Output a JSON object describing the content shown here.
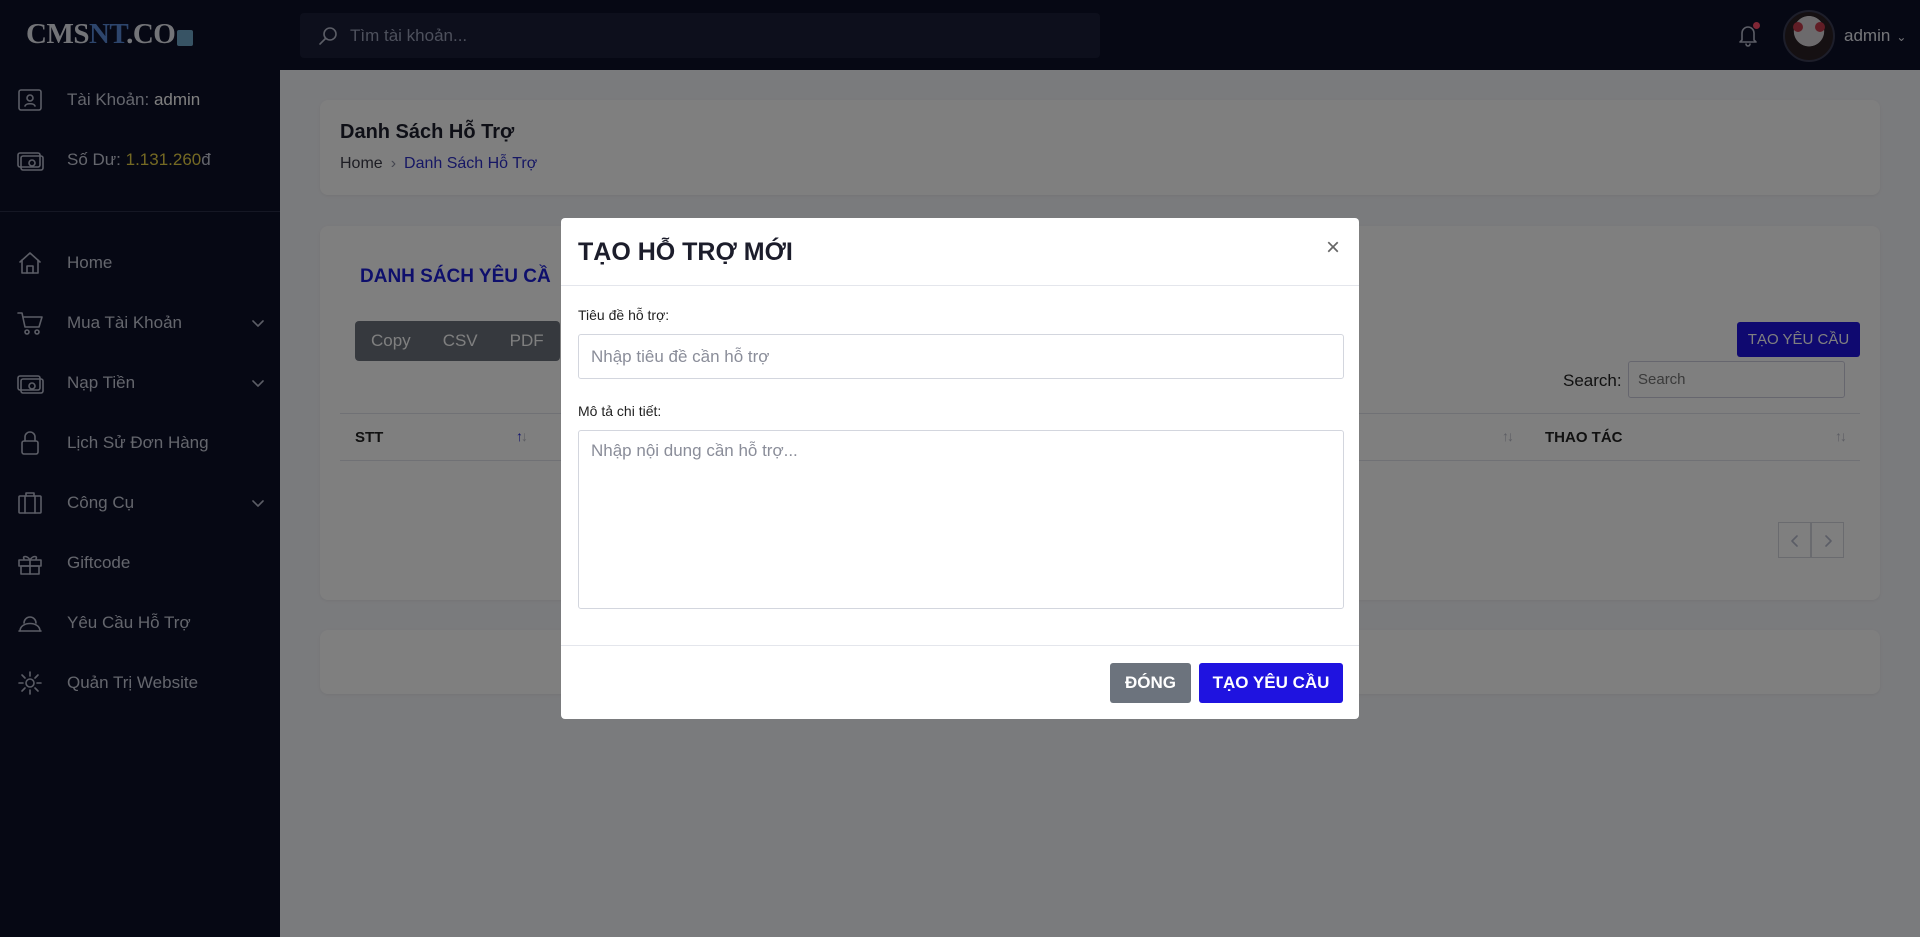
{
  "topbar": {
    "logo_prefix": "CMS",
    "logo_accent": "NT",
    "logo_suffix": ".CO",
    "search_placeholder": "Tìm tài khoản...",
    "username": "admin"
  },
  "sidebar": {
    "account_label": "Tài Khoản: ",
    "account_value": "admin",
    "balance_label": "Số Dư: ",
    "balance_value": "1.131.260",
    "balance_currency": "đ",
    "items": [
      {
        "label": "Home",
        "icon": "home-icon"
      },
      {
        "label": "Mua Tài Khoản",
        "icon": "cart-icon",
        "has_children": true
      },
      {
        "label": "Nạp Tiền",
        "icon": "money-icon",
        "has_children": true
      },
      {
        "label": "Lịch Sử Đơn Hàng",
        "icon": "lock-icon"
      },
      {
        "label": "Công Cụ",
        "icon": "briefcase-icon",
        "has_children": true
      },
      {
        "label": "Giftcode",
        "icon": "gift-icon"
      },
      {
        "label": "Yêu Cầu Hỗ Trợ",
        "icon": "support-icon"
      },
      {
        "label": "Quản Trị Website",
        "icon": "gear-icon"
      }
    ]
  },
  "main": {
    "page_title": "Danh Sách Hỗ Trợ",
    "breadcrumb": {
      "home": "Home",
      "current": "Danh Sách Hỗ Trợ"
    },
    "list_title": "DANH SÁCH YÊU CẦ",
    "export_buttons": [
      "Copy",
      "CSV",
      "PDF"
    ],
    "create_button": "TẠO YÊU CẦU",
    "search_label": "Search:",
    "search_placeholder": "Search",
    "columns": {
      "stt": "STT",
      "actions": "THAO TÁC"
    }
  },
  "modal": {
    "title": "TẠO HỖ TRỢ MỚI",
    "close_symbol": "×",
    "subject_label": "Tiêu đề hỗ trợ:",
    "subject_placeholder": "Nhập tiêu đề cần hỗ trợ",
    "description_label": "Mô tả chi tiết:",
    "description_placeholder": "Nhập nội dung cần hỗ trợ...",
    "close_button": "ĐÓNG",
    "submit_button": "TẠO YÊU CẦU"
  },
  "colors": {
    "sidebar_bg": "#0d1028",
    "accent": "#1f13e0",
    "balance": "#e8d246",
    "secondary_button": "#6c737d"
  }
}
